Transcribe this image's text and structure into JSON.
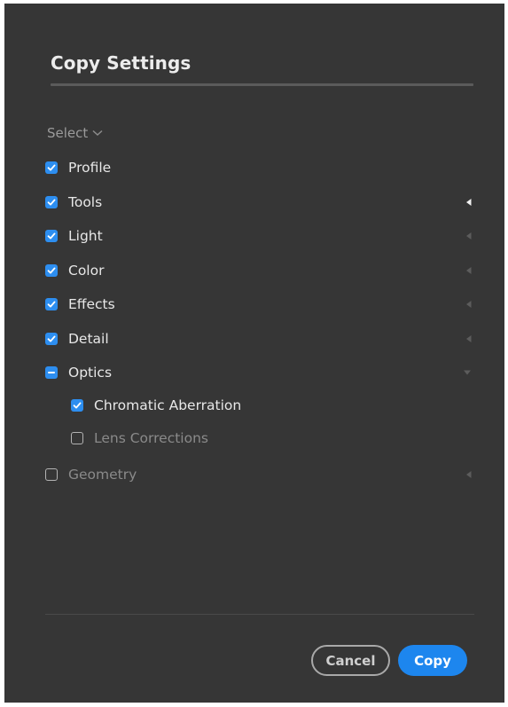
{
  "dialog": {
    "title": "Copy Settings",
    "select_label": "Select",
    "items": [
      {
        "label": "Profile",
        "state": "checked",
        "indent": false,
        "arrow": "none",
        "dim": false
      },
      {
        "label": "Tools",
        "state": "checked",
        "indent": false,
        "arrow": "left-bright",
        "dim": false
      },
      {
        "label": "Light",
        "state": "checked",
        "indent": false,
        "arrow": "left",
        "dim": false
      },
      {
        "label": "Color",
        "state": "checked",
        "indent": false,
        "arrow": "left",
        "dim": false
      },
      {
        "label": "Effects",
        "state": "checked",
        "indent": false,
        "arrow": "left",
        "dim": false
      },
      {
        "label": "Detail",
        "state": "checked",
        "indent": false,
        "arrow": "left",
        "dim": false
      },
      {
        "label": "Optics",
        "state": "mixed",
        "indent": false,
        "arrow": "down",
        "dim": false
      },
      {
        "label": "Chromatic Aberration",
        "state": "checked",
        "indent": true,
        "arrow": "none",
        "dim": false
      },
      {
        "label": "Lens Corrections",
        "state": "unchecked",
        "indent": true,
        "arrow": "none",
        "dim": true
      },
      {
        "label": "Geometry",
        "state": "unchecked",
        "indent": false,
        "arrow": "left",
        "dim": true
      }
    ],
    "cancel_label": "Cancel",
    "copy_label": "Copy"
  },
  "colors": {
    "background": "#363636",
    "accent": "#1d86ee",
    "checkbox": "#2d8ef0"
  }
}
